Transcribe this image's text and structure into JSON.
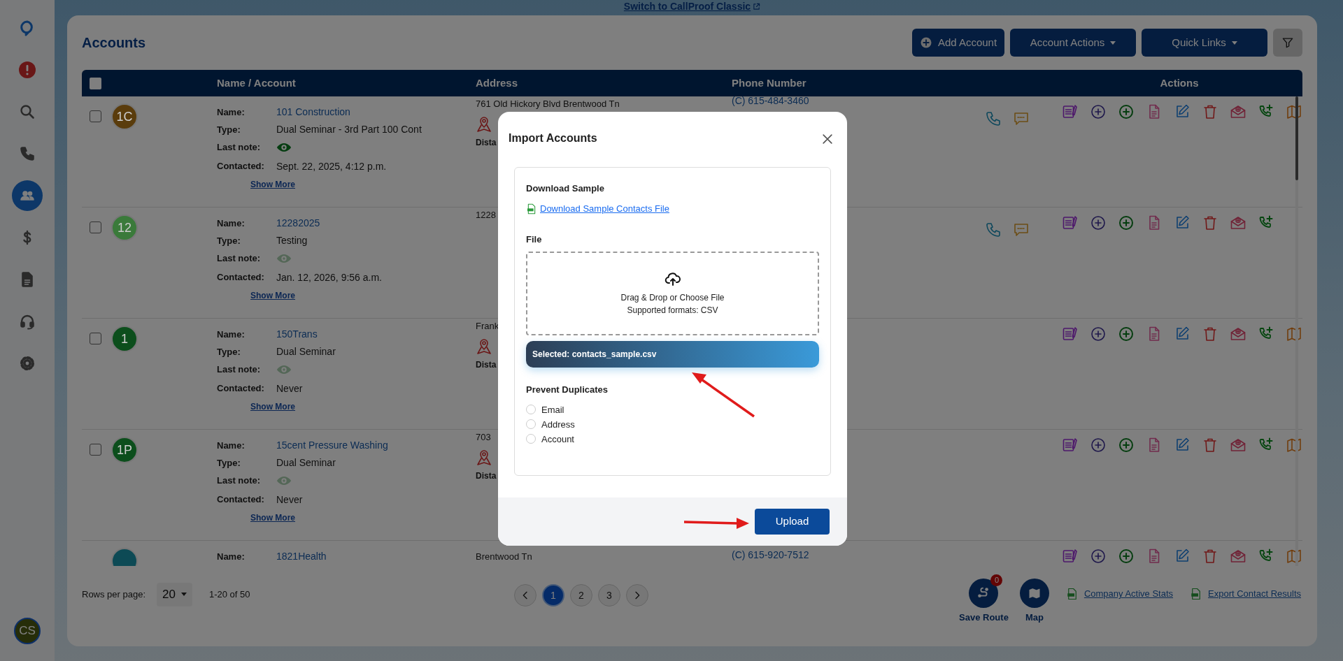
{
  "top_link": "Switch to CallProof Classic",
  "sidebar": {
    "items": [
      {
        "kind": "logo",
        "selected": false
      },
      {
        "kind": "alert",
        "selected": false
      },
      {
        "kind": "search",
        "selected": false
      },
      {
        "kind": "phone",
        "selected": false
      },
      {
        "kind": "contacts",
        "selected": true
      },
      {
        "kind": "dollar",
        "selected": false
      },
      {
        "kind": "document",
        "selected": false
      },
      {
        "kind": "headset",
        "selected": false
      },
      {
        "kind": "settings",
        "selected": false
      }
    ],
    "user_initials": "CS"
  },
  "page_title": "Accounts",
  "header_buttons": [
    {
      "kind": "add",
      "label": "Add Account"
    },
    {
      "kind": "dropdown",
      "label": "Account Actions"
    },
    {
      "kind": "dropdown",
      "label": "Quick Links"
    },
    {
      "kind": "filter"
    }
  ],
  "table": {
    "select_all_checked": false,
    "columns": [
      "Name / Account",
      "Address",
      "Phone Number",
      "Actions"
    ],
    "rows": [
      {
        "checked": false,
        "initials": "1C",
        "color": "#5a3c0c",
        "name_label": "Name:",
        "name": "101 Construction",
        "type_label": "Type:",
        "type": "Dual Seminar - 3rd Part 100 Cont",
        "note_label": "Last note:",
        "has_note": true,
        "contacted_label": "Contacted:",
        "contacted": "Sept. 22, 2025, 4:12 p.m.",
        "show_more": "Show More",
        "address": "761 Old Hickory Blvd Brentwood Tn",
        "pin": true,
        "distance_label": "Dista",
        "phone": "(C) 615-484-3460",
        "call_actions": true,
        "map_action": true
      },
      {
        "checked": false,
        "initials": "12",
        "color": "#3a7a3a",
        "name_label": "Name:",
        "name": "12282025",
        "type_label": "Type:",
        "type": "Testing",
        "note_label": "Last note:",
        "has_note": false,
        "contacted_label": "Contacted:",
        "contacted": "Jan. 12, 2026, 9:56 a.m.",
        "show_more": "Show More",
        "address": "1228",
        "pin": false,
        "call_actions": true,
        "map_action": false
      },
      {
        "checked": false,
        "initials": "1",
        "color": "#0c4e1c",
        "name_label": "Name:",
        "name": "150Trans",
        "type_label": "Type:",
        "type": "Dual Seminar",
        "note_label": "Last note:",
        "has_note": false,
        "contacted_label": "Contacted:",
        "contacted": "Never",
        "show_more": "Show More",
        "address": "Frank",
        "pin": true,
        "distance_label": "Dista",
        "call_actions": false,
        "map_action": true
      },
      {
        "checked": false,
        "initials": "1P",
        "color": "#0c4e1c",
        "name_label": "Name:",
        "name": "15cent Pressure Washing",
        "type_label": "Type:",
        "type": "Dual Seminar",
        "note_label": "Last note:",
        "has_note": false,
        "contacted_label": "Contacted:",
        "contacted": "Never",
        "show_more": "Show More",
        "address": "703",
        "pin": true,
        "distance_label": "Dista",
        "call_actions": false,
        "map_action": true
      },
      {
        "color": "#0d4a55",
        "name_label": "Name:",
        "name": "1821Health",
        "address": "Brentwood Tn",
        "phone": "(C) 615-920-7512",
        "call_actions": false,
        "map_action": true
      }
    ]
  },
  "footer": {
    "rows_label": "Rows per page:",
    "rows_value": "20",
    "range": "1-20 of 50",
    "pages": [
      {
        "label": "1",
        "selected": true
      },
      {
        "label": "2",
        "selected": false
      },
      {
        "label": "3",
        "selected": false
      }
    ],
    "save_route": {
      "label": "Save Route",
      "badge": "0"
    },
    "map": {
      "label": "Map"
    },
    "links": [
      "Company Active Stats",
      "Export Contact Results"
    ]
  },
  "modal": {
    "title": "Import Accounts",
    "sample_heading": "Download Sample",
    "sample_link": "Download Sample Contacts File",
    "file_heading": "File",
    "drop_text": "Drag & Drop or Choose File",
    "drop_formats": "Supported formats: CSV",
    "selected_file": "Selected: contacts_sample.csv",
    "dedupe_heading": "Prevent Duplicates",
    "dedupe_options": [
      {
        "label": "Email",
        "selected": false
      },
      {
        "label": "Address",
        "selected": false
      },
      {
        "label": "Account",
        "selected": false
      }
    ],
    "submit": "Upload"
  }
}
